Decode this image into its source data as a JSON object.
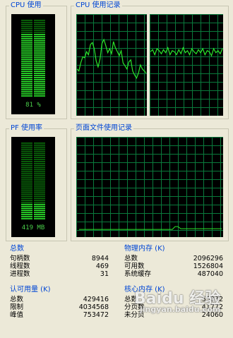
{
  "cpu_usage": {
    "title": "CPU 使用",
    "value_label": "81 %",
    "level": 0.81
  },
  "cpu_history": {
    "title": "CPU 使用记录",
    "core1": [
      46,
      44,
      52,
      58,
      57,
      63,
      60,
      70,
      72,
      66,
      54,
      48,
      56,
      71,
      75,
      69,
      62,
      66,
      61,
      73,
      67,
      63,
      59,
      64,
      52,
      49,
      46,
      53,
      55,
      44,
      40,
      37,
      42,
      50,
      46,
      44,
      42
    ],
    "core2": [
      63,
      65,
      60,
      66,
      64,
      61,
      65,
      62,
      67,
      60,
      64,
      63,
      60,
      65,
      61,
      67,
      62,
      64,
      60,
      66,
      63,
      61,
      65,
      62,
      66,
      60,
      64,
      63,
      59,
      66,
      62,
      64,
      61,
      66
    ]
  },
  "pf_usage": {
    "title": "PF 使用率",
    "value_label": "419 MB",
    "level": 0.2
  },
  "pagefile_history": {
    "title": "页面文件使用记录",
    "level": 0.2
  },
  "totals": {
    "title": "总数",
    "rows": [
      {
        "label": "句柄数",
        "value": "8944"
      },
      {
        "label": "线程数",
        "value": "469"
      },
      {
        "label": "进程数",
        "value": "31"
      }
    ]
  },
  "physical_memory": {
    "title": "物理内存 (K)",
    "rows": [
      {
        "label": "总数",
        "value": "2096296"
      },
      {
        "label": "可用数",
        "value": "1526804"
      },
      {
        "label": "系统缓存",
        "value": "487040"
      }
    ]
  },
  "commit_charge": {
    "title": "认可用量 (K)",
    "rows": [
      {
        "label": "总数",
        "value": "429416"
      },
      {
        "label": "限制",
        "value": "4034568"
      },
      {
        "label": "峰值",
        "value": "753472"
      }
    ]
  },
  "kernel_memory": {
    "title": "核心内存 (K)",
    "rows": [
      {
        "label": "总数",
        "value": "55832"
      },
      {
        "label": "分页数",
        "value": "41772"
      },
      {
        "label": "未分页",
        "value": "24060"
      }
    ]
  },
  "watermark": {
    "brand": "Baidu 经验",
    "url": "jingyan.baidu.com"
  },
  "colors": {
    "meter_on": "#2be62b",
    "meter_off": "#0a6a0a",
    "grid": "#0a7a3c",
    "line": "#2be62b",
    "caption": "#0046d5"
  }
}
